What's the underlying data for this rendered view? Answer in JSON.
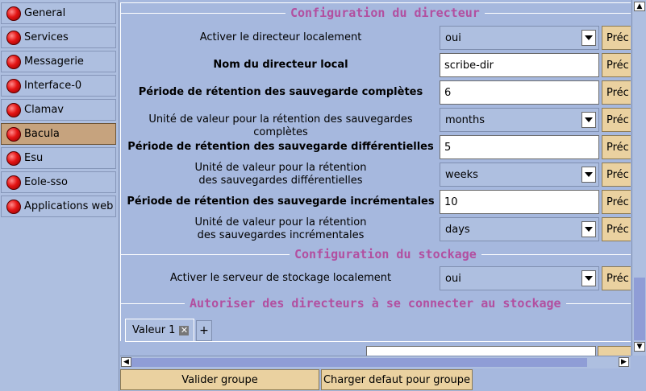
{
  "sidebar": {
    "items": [
      {
        "label": "General"
      },
      {
        "label": "Services"
      },
      {
        "label": "Messagerie"
      },
      {
        "label": "Interface-0"
      },
      {
        "label": "Clamav"
      },
      {
        "label": "Bacula",
        "active": true
      },
      {
        "label": "Esu"
      },
      {
        "label": "Eole-sso"
      },
      {
        "label": "Applications web"
      }
    ]
  },
  "sections": {
    "directeur": "Configuration du directeur",
    "stockage": "Configuration du stockage",
    "autoriser": "Autoriser des directeurs à se connecter au stockage"
  },
  "rows": [
    {
      "label": "Activer le directeur localement",
      "value": "oui",
      "type": "select"
    },
    {
      "label": "Nom du directeur local",
      "value": "scribe-dir",
      "type": "input"
    },
    {
      "label": "Période de rétention des sauvegarde complètes",
      "value": "6",
      "type": "input"
    },
    {
      "label": "Unité de valeur pour la rétention des sauvegardes complètes",
      "value": "months",
      "type": "select"
    },
    {
      "label": "Période de rétention des sauvegarde différentielles",
      "value": "5",
      "type": "input"
    },
    {
      "label_line1": "Unité de valeur pour la rétention",
      "label_line2": "des sauvegardes différentielles",
      "value": "weeks",
      "type": "select"
    },
    {
      "label": "Période de rétention des sauvegarde incrémentales",
      "value": "10",
      "type": "input"
    },
    {
      "label_line1": "Unité de valeur pour la rétention",
      "label_line2": "des sauvegardes incrémentales",
      "value": "days",
      "type": "select"
    },
    {
      "label": "Activer le serveur de stockage localement",
      "value": "oui",
      "type": "select"
    }
  ],
  "pred_label": "Préc",
  "tabs": {
    "valeur": "Valeur 1",
    "add": "+"
  },
  "buttons": {
    "valider": "Valider groupe",
    "charger": "Charger defaut pour groupe"
  }
}
